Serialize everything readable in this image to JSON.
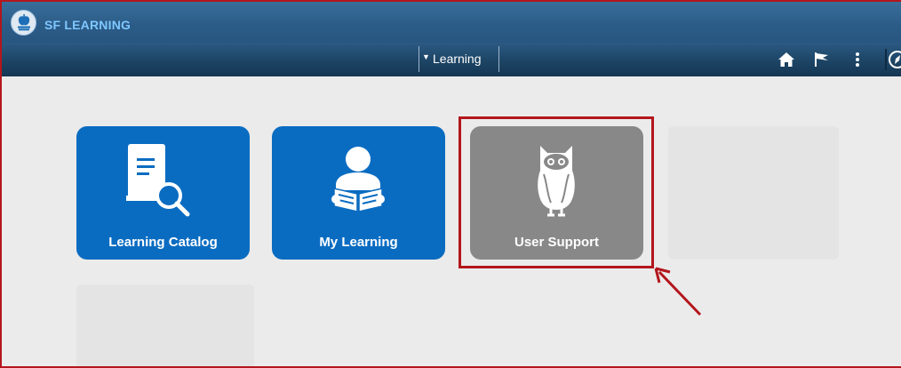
{
  "header": {
    "app_title": "SF LEARNING",
    "logo_icon": "apple-books-icon",
    "brand_color": "#7fc7ff"
  },
  "navbar": {
    "dropdown_label": "Learning",
    "icons": [
      "home-icon",
      "flag-icon",
      "more-vertical-icon",
      "compass-icon"
    ]
  },
  "tiles": [
    {
      "label": "Learning Catalog",
      "icon": "book-search-icon",
      "color": "#0a6cc1"
    },
    {
      "label": "My Learning",
      "icon": "reader-icon",
      "color": "#0a6cc1"
    },
    {
      "label": "User Support",
      "icon": "owl-icon",
      "color": "#888888"
    }
  ],
  "annotation": {
    "highlight_color": "#b3161c"
  }
}
